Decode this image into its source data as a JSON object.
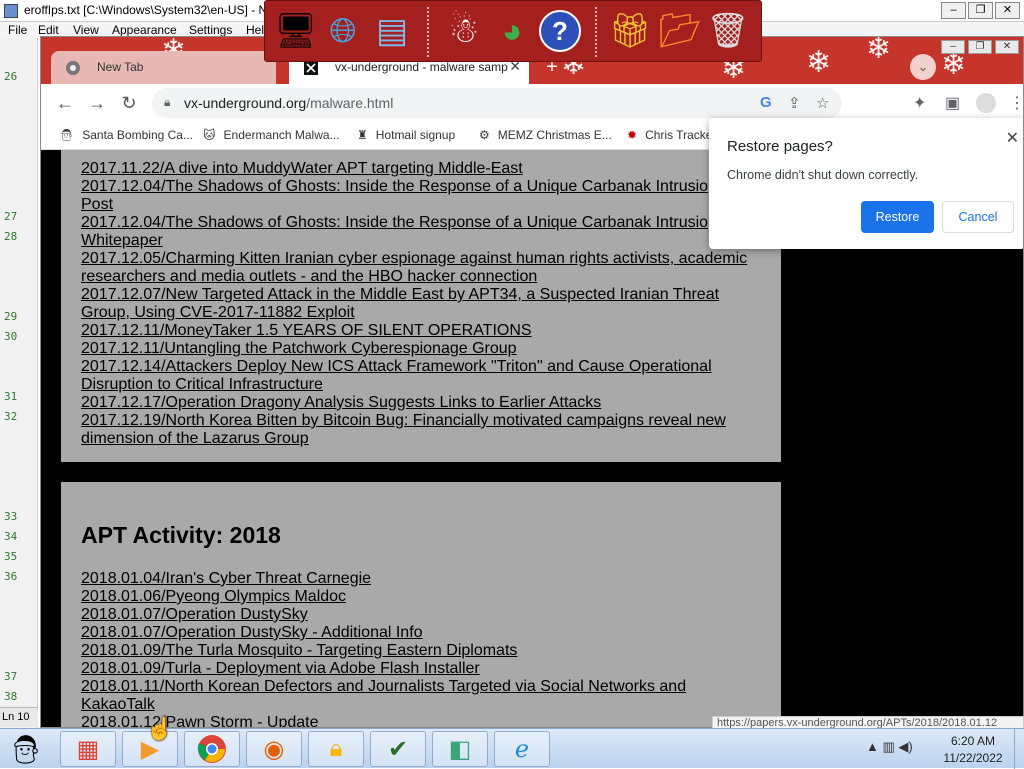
{
  "editor": {
    "title": "eroffIps.txt [C:\\Windows\\System32\\en-US] - N",
    "menu": [
      "File",
      "Edit",
      "View",
      "Appearance",
      "Settings",
      "Hel"
    ],
    "line_numbers": [
      "26",
      "27",
      "28",
      "29",
      "30",
      "31",
      "32",
      "33",
      "34",
      "35",
      "36",
      "37",
      "38"
    ],
    "status_ln": "Ln 10"
  },
  "chrome": {
    "tabs": [
      {
        "title": "New Tab"
      },
      {
        "title": "vx-underground - malware samp"
      }
    ],
    "url_host": "vx-underground.org",
    "url_path": "/malware.html",
    "bookmarks": [
      {
        "label": "Santa Bombing Ca...",
        "icon": "santa-icon"
      },
      {
        "label": "Endermanch Malwa...",
        "icon": "cat-icon"
      },
      {
        "label": "Hotmail signup",
        "icon": "person-icon"
      },
      {
        "label": "MEMZ Christmas E...",
        "icon": "memz-icon"
      },
      {
        "label": "Chris Tracke",
        "icon": "star-icon"
      }
    ],
    "status_url": "https://papers.vx-underground.org/APTs/2018/2018.01.12"
  },
  "page": {
    "links_2017": [
      "2017.11.22/A dive into MuddyWater APT targeting Middle-East",
      "2017.12.04/The Shadows of Ghosts: Inside the Response of a Unique Carbanak Intrusio",
      "Post",
      "2017.12.04/The Shadows of Ghosts: Inside the Response of a Unique Carbanak Intrusio",
      "Whitepaper",
      "2017.12.05/Charming Kitten Iranian cyber espionage against human rights activists, academic",
      "researchers and media outlets - and the HBO hacker connection",
      "2017.12.07/New Targeted Attack in the Middle East by APT34, a Suspected Iranian Threat",
      "Group, Using CVE-2017-11882 Exploit",
      "2017.12.11/MoneyTaker 1.5 YEARS OF SILENT OPERATIONS",
      "2017.12.11/Untangling the Patchwork Cyberespionage Group",
      "2017.12.14/Attackers Deploy New ICS Attack Framework \"Triton\" and Cause Operational",
      "Disruption to Critical Infrastructure",
      "2017.12.17/Operation Dragony Analysis Suggests Links to Earlier Attacks",
      "2017.12.19/North Korea Bitten by Bitcoin Bug: Financially motivated campaigns reveal new",
      "dimension of the Lazarus Group"
    ],
    "heading_2018": "APT Activity: 2018",
    "links_2018": [
      "2018.01.04/Iran's Cyber Threat Carnegie",
      "2018.01.06/Pyeong Olympics Maldoc",
      "2018.01.07/Operation DustySky",
      "2018.01.07/Operation DustySky - Additional Info",
      "2018.01.09/The Turla Mosquito - Targeting Eastern Diplomats",
      "2018.01.09/Turla - Deployment via Adobe Flash Installer",
      "2018.01.11/North Korean Defectors and Journalists Targeted via Social Networks and",
      "KakaoTalk",
      "2018.01.12/Pawn Storm - Update"
    ]
  },
  "restore_dialog": {
    "title": "Restore pages?",
    "message": "Chrome didn't shut down correctly.",
    "restore_label": "Restore",
    "cancel_label": "Cancel"
  },
  "dock_icons": [
    "monitor-santa-icon",
    "globe-icon",
    "control-panel-icon",
    "snowman-icon",
    "windows-update-icon",
    "help-icon",
    "gift-icon",
    "folder-icon",
    "recycle-bin-icon"
  ],
  "taskbar": {
    "apps": [
      "file-explorer-icon",
      "media-player-icon",
      "chrome-icon",
      "firefox-icon",
      "lock-app-icon",
      "task-check-icon",
      "notebook-icon",
      "internet-explorer-icon"
    ],
    "time": "6:20 AM",
    "date": "11/22/2022"
  }
}
